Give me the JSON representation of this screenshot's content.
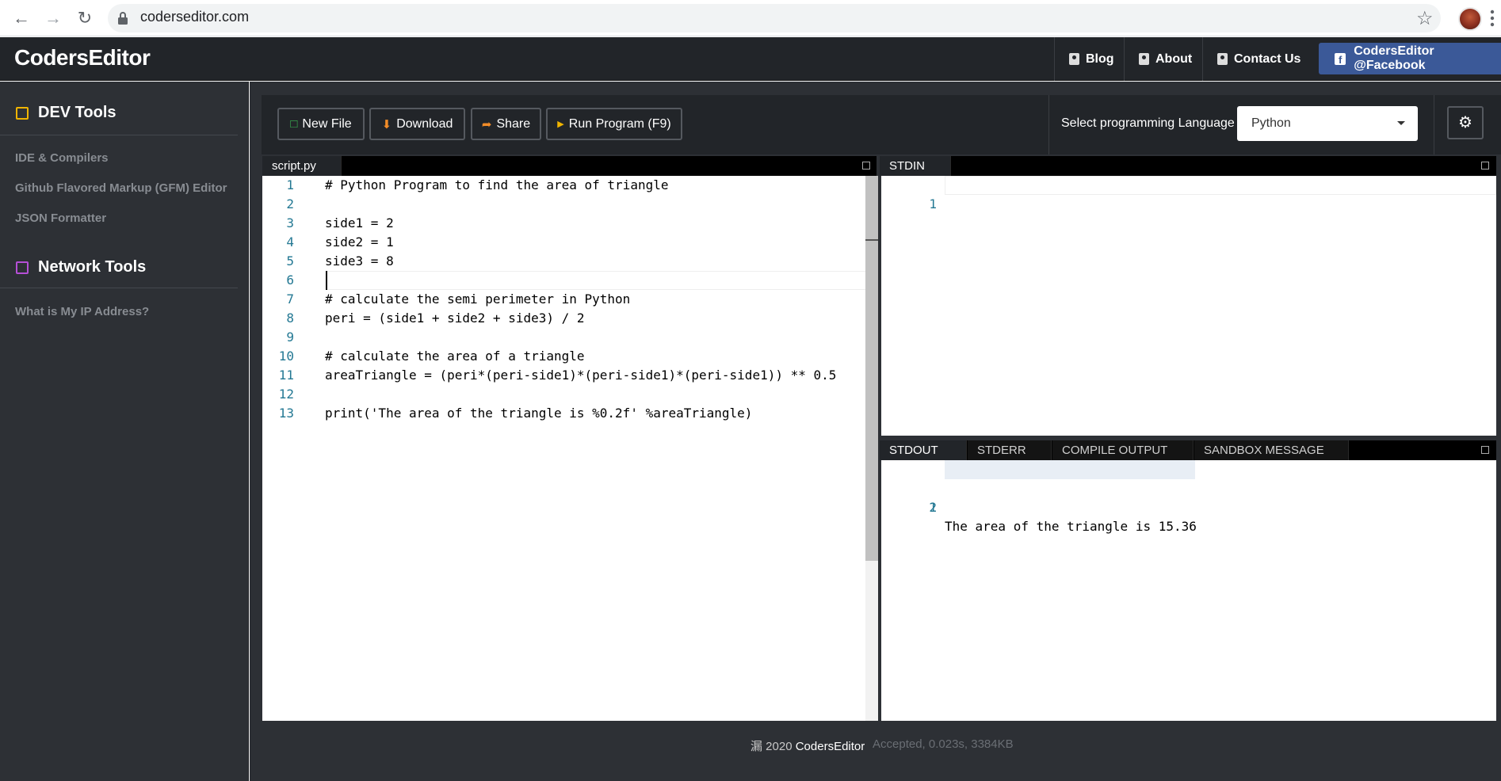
{
  "browser": {
    "url": "coderseditor.com"
  },
  "header": {
    "brand": "CodersEditor",
    "links": [
      "Blog",
      "About",
      "Contact Us"
    ],
    "facebook_label": "CodersEditor @Facebook",
    "facebook_color": "#3b5998"
  },
  "sidebar": {
    "dev_tools_title": "DEV Tools",
    "dev_tools_color": "#f0b400",
    "dev_items": [
      "IDE & Compilers",
      "Github Flavored Markup (GFM) Editor",
      "JSON Formatter"
    ],
    "network_tools_title": "Network Tools",
    "network_tools_color": "#b54fd6",
    "network_items": [
      "What is My IP Address?"
    ]
  },
  "toolbar": {
    "new_file": "New File",
    "download": "Download",
    "share": "Share",
    "run": "Run Program (F9)",
    "language_label": "Select programming Language",
    "language_value": "Python",
    "accent_green": "#3cba54",
    "accent_orange": "#f28c28"
  },
  "editor": {
    "filename": "script.py",
    "lines": [
      "# Python Program to find the area of triangle",
      "",
      "side1 = 2",
      "side2 = 1",
      "side3 = 8",
      "",
      "# calculate the semi perimeter in Python",
      "peri = (side1 + side2 + side3) / 2",
      "",
      "# calculate the area of a triangle",
      "areaTriangle = (peri*(peri-side1)*(peri-side1)*(peri-side1)) ** 0.5",
      "",
      "print('The area of the triangle is %0.2f' %areaTriangle)"
    ],
    "line_numbers": [
      "1",
      "2",
      "3",
      "4",
      "5",
      "6",
      "7",
      "8",
      "9",
      "10",
      "11",
      "12",
      "13"
    ]
  },
  "stdin": {
    "tab": "STDIN",
    "line_numbers": [
      "1"
    ]
  },
  "output": {
    "tabs": [
      "STDOUT",
      "STDERR",
      "COMPILE OUTPUT",
      "SANDBOX MESSAGE"
    ],
    "line_numbers": [
      "1",
      "2"
    ],
    "lines": [
      "The area of the triangle is 15.36",
      ""
    ]
  },
  "footer": {
    "copyright_prefix": "漏 2020",
    "brand": "CodersEditor",
    "status": "Accepted, 0.023s, 3384KB"
  }
}
